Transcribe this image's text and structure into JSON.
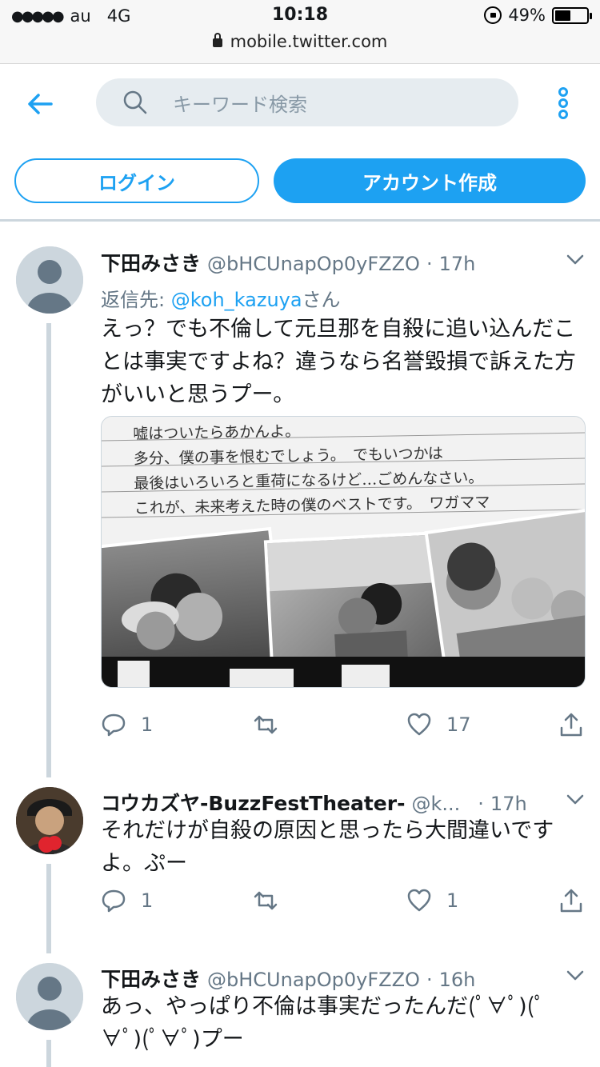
{
  "status_bar": {
    "carrier": "au",
    "network": "4G",
    "time": "10:18",
    "battery_text": "49%",
    "battery_level": 0.49,
    "url": "mobile.twitter.com"
  },
  "header": {
    "search_placeholder": "キーワード検索",
    "login_label": "ログイン",
    "signup_label": "アカウント作成"
  },
  "tweets": [
    {
      "name": "下田みさき",
      "handle": "@bHCUnapOp0yFZZO",
      "dot": "·",
      "time": "17h",
      "reply_prefix": "返信先: ",
      "reply_mention": "@koh_kazuya",
      "reply_suffix": "さん",
      "text": "えっ？でも不倫して元旦那を自殺に追い込んだことは事実ですよね？違うなら名誉毀損で訴えた方がいいと思うプー。",
      "replies": "1",
      "retweets": "",
      "likes": "17",
      "media_text_lines": [
        "嘘はついたらあかんよ。",
        "多分、僕の事を恨むでしょう。　でもいつかは",
        "最後はいろいろと重荷になるけど…ごめんなさい。",
        "これが、未来考えた時の僕のベストです。　ワガママ"
      ]
    },
    {
      "name": "コウカズヤ-BuzzFestTheater-",
      "handle": "@k...",
      "dot": "·",
      "time": "17h",
      "text": "それだけが自殺の原因と思ったら大間違いですよ。ぷー",
      "replies": "1",
      "retweets": "",
      "likes": "1"
    },
    {
      "name": "下田みさき",
      "handle": "@bHCUnapOp0yFZZO",
      "dot": "·",
      "time": "16h",
      "text": "あっ、やっぱり不倫は事実だったんだ(ﾟ∀ﾟ)(ﾟ∀ﾟ)(ﾟ∀ﾟ)プー"
    }
  ],
  "colors": {
    "accent": "#1da1f2",
    "muted": "#657786",
    "line": "#ccd6dd"
  },
  "icons": [
    "back-arrow-icon",
    "search-icon",
    "more-vertical-icon",
    "chevron-down-icon",
    "reply-icon",
    "retweet-icon",
    "like-icon",
    "share-icon"
  ]
}
